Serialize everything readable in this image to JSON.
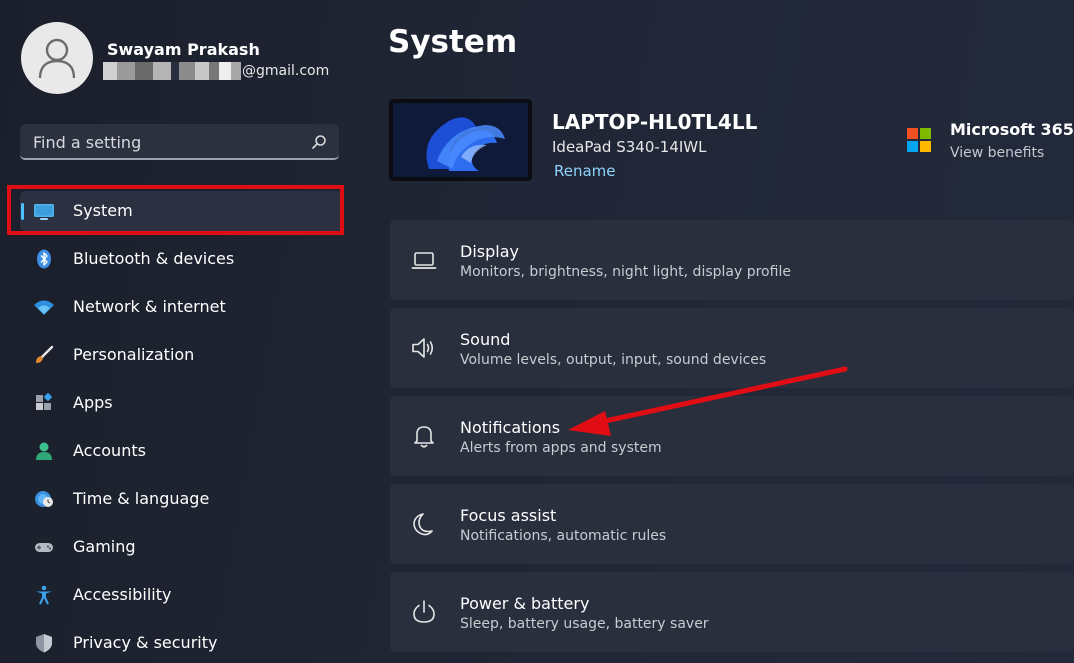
{
  "user": {
    "name": "Swayam Prakash",
    "email_suffix": "@gmail.com"
  },
  "search": {
    "placeholder": "Find a setting"
  },
  "sidebar": {
    "items": [
      {
        "label": "System",
        "icon": "monitor-icon",
        "active": true
      },
      {
        "label": "Bluetooth & devices",
        "icon": "bluetooth-icon"
      },
      {
        "label": "Network & internet",
        "icon": "wifi-icon"
      },
      {
        "label": "Personalization",
        "icon": "brush-icon"
      },
      {
        "label": "Apps",
        "icon": "apps-icon"
      },
      {
        "label": "Accounts",
        "icon": "person-icon"
      },
      {
        "label": "Time & language",
        "icon": "globe-clock-icon"
      },
      {
        "label": "Gaming",
        "icon": "gamepad-icon"
      },
      {
        "label": "Accessibility",
        "icon": "accessibility-icon"
      },
      {
        "label": "Privacy & security",
        "icon": "shield-icon"
      }
    ]
  },
  "main": {
    "title": "System",
    "device": {
      "name": "LAPTOP-HL0TL4LL",
      "model": "IdeaPad S340-14IWL",
      "rename": "Rename"
    },
    "microsoft365": {
      "title": "Microsoft 365",
      "subtitle": "View benefits"
    },
    "cards": [
      {
        "title": "Display",
        "subtitle": "Monitors, brightness, night light, display profile",
        "icon": "laptop-icon"
      },
      {
        "title": "Sound",
        "subtitle": "Volume levels, output, input, sound devices",
        "icon": "speaker-icon"
      },
      {
        "title": "Notifications",
        "subtitle": "Alerts from apps and system",
        "icon": "bell-icon"
      },
      {
        "title": "Focus assist",
        "subtitle": "Notifications, automatic rules",
        "icon": "moon-icon"
      },
      {
        "title": "Power & battery",
        "subtitle": "Sleep, battery usage, battery saver",
        "icon": "power-icon"
      }
    ]
  },
  "colors": {
    "accent": "#4cc2ff",
    "annotation_red": "#e10d14",
    "background": "#202635",
    "card": "#2a2f3d"
  }
}
